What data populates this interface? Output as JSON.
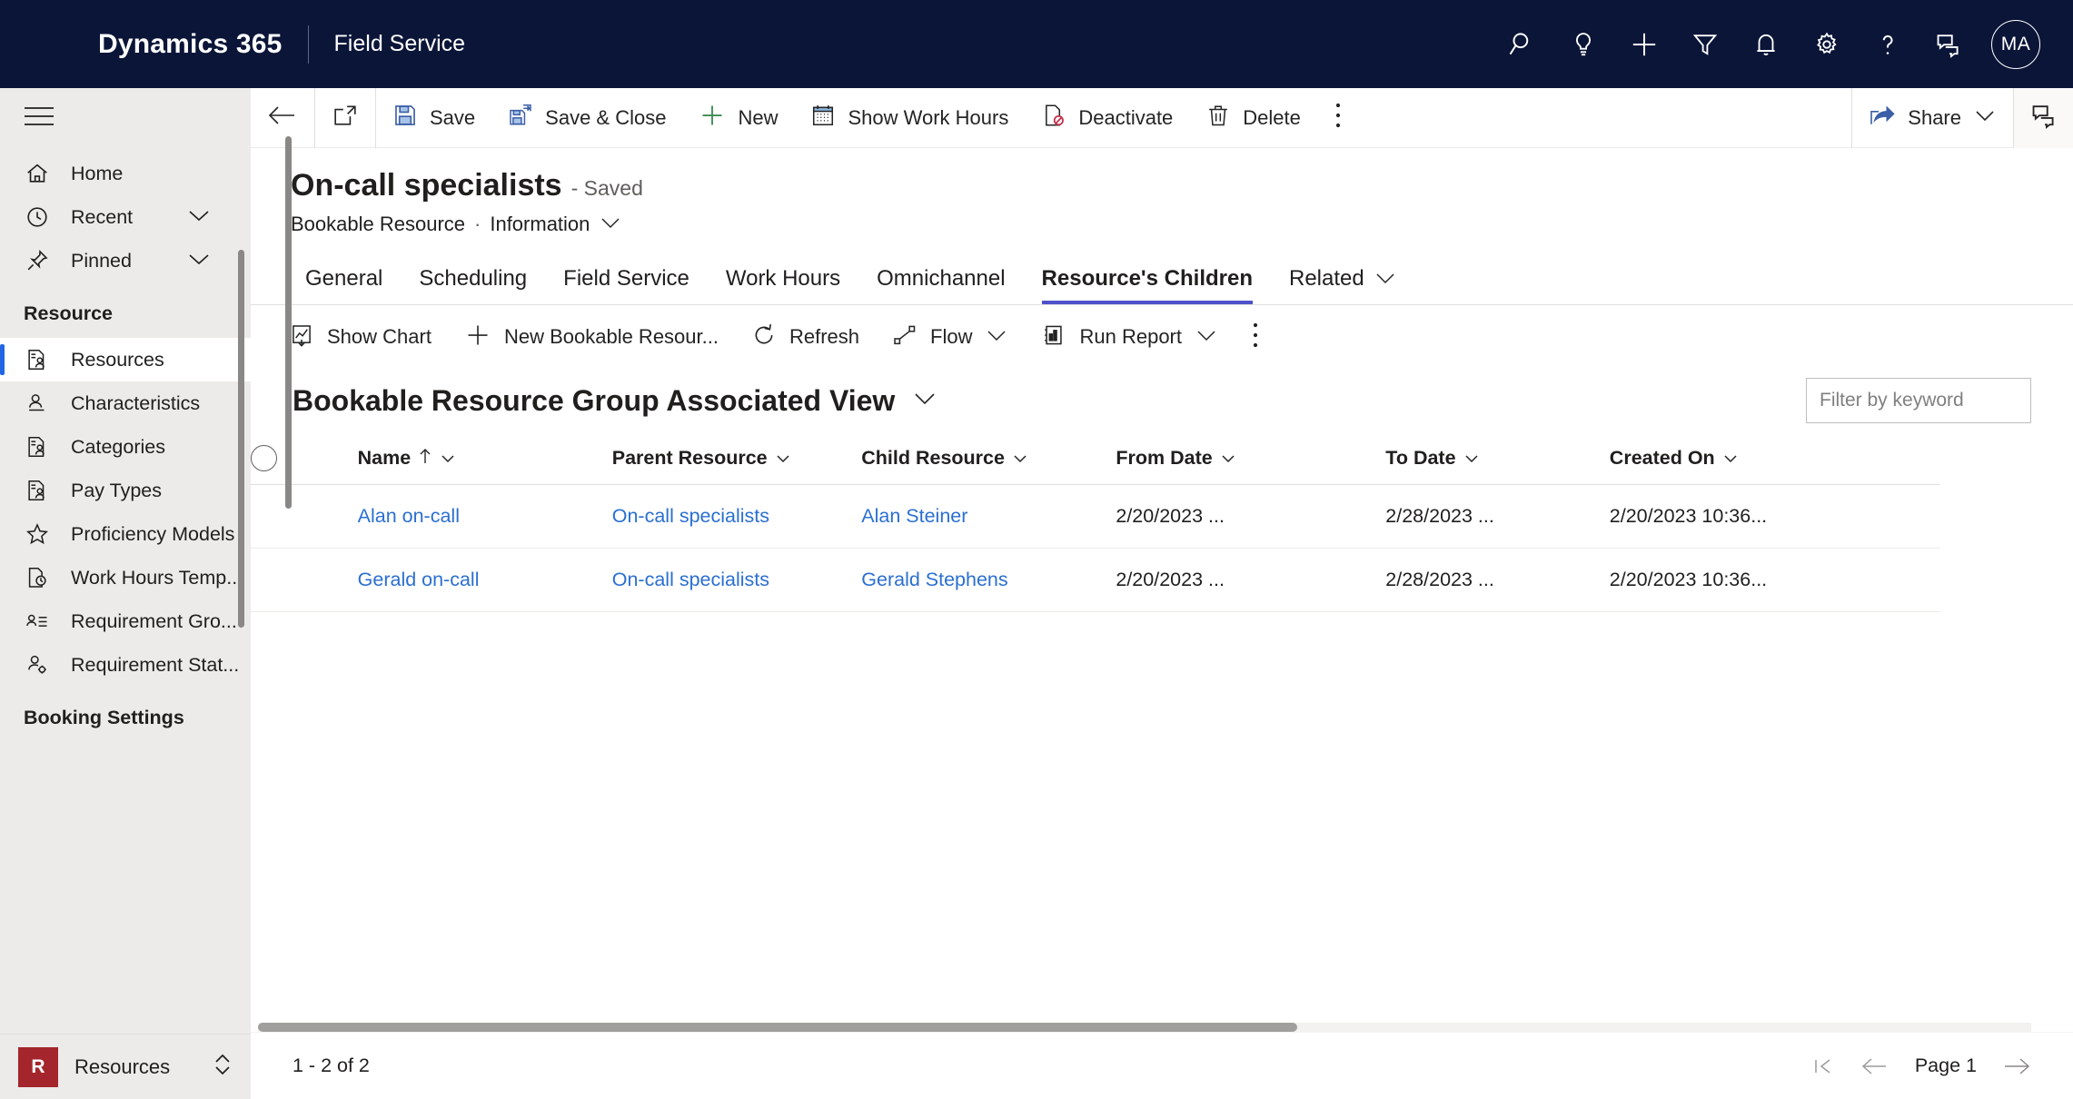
{
  "topbar": {
    "brand": "Dynamics 365",
    "app_name": "Field Service",
    "icons": [
      {
        "name": "search-icon",
        "title": "Search"
      },
      {
        "name": "lightbulb-icon",
        "title": "Insights"
      },
      {
        "name": "plus-icon",
        "title": "New"
      },
      {
        "name": "filter-icon",
        "title": "Filter"
      },
      {
        "name": "bell-icon",
        "title": "Notifications"
      },
      {
        "name": "gear-icon",
        "title": "Settings"
      },
      {
        "name": "question-icon",
        "title": "Help"
      },
      {
        "name": "chat-icon",
        "title": "Feedback"
      }
    ],
    "avatar_initials": "MA"
  },
  "sidebar": {
    "hamburger": "site-map-icon",
    "items": [
      {
        "label": "Home",
        "icon": "home-icon",
        "chevron": false,
        "active": false
      },
      {
        "label": "Recent",
        "icon": "clock-icon",
        "chevron": true,
        "active": false
      },
      {
        "label": "Pinned",
        "icon": "pin-icon",
        "chevron": true,
        "active": false
      }
    ],
    "group_label": "Resource",
    "group_items": [
      {
        "label": "Resources",
        "icon": "resource-icon",
        "active": true
      },
      {
        "label": "Characteristics",
        "icon": "person-line-icon",
        "active": false
      },
      {
        "label": "Categories",
        "icon": "resource-icon",
        "active": false
      },
      {
        "label": "Pay Types",
        "icon": "resource-icon",
        "active": false
      },
      {
        "label": "Proficiency Models",
        "icon": "star-icon",
        "active": false
      },
      {
        "label": "Work Hours Temp...",
        "icon": "clock-doc-icon",
        "active": false
      },
      {
        "label": "Requirement Gro...",
        "icon": "requirement-icon",
        "active": false
      },
      {
        "label": "Requirement Stat...",
        "icon": "person-gear-icon",
        "active": false
      }
    ],
    "group2_label": "Booking Settings",
    "footer": {
      "badge": "R",
      "name": "Resources",
      "switcher_icon": "chevron-updown-icon"
    }
  },
  "commandbar": {
    "back": "back-arrow-icon",
    "popout": "open-in-new-icon",
    "buttons": [
      {
        "label": "Save",
        "icon": "save-icon"
      },
      {
        "label": "Save & Close",
        "icon": "save-close-icon"
      },
      {
        "label": "New",
        "icon": "plus-icon"
      },
      {
        "label": "Show Work Hours",
        "icon": "calendar-icon"
      },
      {
        "label": "Deactivate",
        "icon": "deactivate-icon"
      },
      {
        "label": "Delete",
        "icon": "trash-icon"
      }
    ],
    "overflow": "more-vertical-icon",
    "share_label": "Share",
    "share_icon": "share-icon",
    "feedback_icon": "feedback-icon"
  },
  "record": {
    "title": "On-call specialists",
    "status": "- Saved",
    "entity": "Bookable Resource",
    "separator": "·",
    "form": "Information"
  },
  "tabs": [
    {
      "label": "General",
      "active": false,
      "chevron": false
    },
    {
      "label": "Scheduling",
      "active": false,
      "chevron": false
    },
    {
      "label": "Field Service",
      "active": false,
      "chevron": false
    },
    {
      "label": "Work Hours",
      "active": false,
      "chevron": false
    },
    {
      "label": "Omnichannel",
      "active": false,
      "chevron": false
    },
    {
      "label": "Resource's Children",
      "active": true,
      "chevron": false
    },
    {
      "label": "Related",
      "active": false,
      "chevron": true
    }
  ],
  "subcommandbar": {
    "buttons": [
      {
        "label": "Show Chart",
        "icon": "chart-icon",
        "chevron": false
      },
      {
        "label": "New Bookable Resour...",
        "icon": "plus-icon",
        "chevron": false
      },
      {
        "label": "Refresh",
        "icon": "refresh-icon",
        "chevron": false
      },
      {
        "label": "Flow",
        "icon": "flow-icon",
        "chevron": true
      },
      {
        "label": "Run Report",
        "icon": "report-icon",
        "chevron": true
      }
    ],
    "overflow": "more-vertical-icon"
  },
  "view": {
    "title": "Bookable Resource Group Associated View",
    "selector_icon": "chevron-down-icon",
    "filter_placeholder": "Filter by keyword",
    "filter_value": ""
  },
  "table": {
    "select_all": "select-all-circle",
    "columns": [
      {
        "label": "Name",
        "sorted": true,
        "sort_dir": "asc",
        "chevron": true
      },
      {
        "label": "Parent Resource",
        "sorted": false,
        "chevron": true
      },
      {
        "label": "Child Resource",
        "sorted": false,
        "chevron": true
      },
      {
        "label": "From Date",
        "sorted": false,
        "chevron": true
      },
      {
        "label": "To Date",
        "sorted": false,
        "chevron": true
      },
      {
        "label": "Created On",
        "sorted": false,
        "chevron": true
      }
    ],
    "rows": [
      {
        "name": "Alan on-call",
        "parent_resource": "On-call specialists",
        "child_resource": "Alan Steiner",
        "from_date": "2/20/2023 ...",
        "to_date": "2/28/2023 ...",
        "created_on": "2/20/2023 10:36..."
      },
      {
        "name": "Gerald on-call",
        "parent_resource": "On-call specialists",
        "child_resource": "Gerald Stephens",
        "from_date": "2/20/2023 ...",
        "to_date": "2/28/2023 ...",
        "created_on": "2/20/2023 10:36..."
      }
    ]
  },
  "pager": {
    "count_text": "1 - 2 of 2",
    "first_icon": "first-page-icon",
    "prev_icon": "prev-page-icon",
    "page_label": "Page 1",
    "next_icon": "next-page-icon"
  },
  "colors": {
    "topbar_bg": "#0B1538",
    "accent": "#2266E3",
    "tab_underline": "#4F52C9",
    "link": "#2A6FD1",
    "sidebar_bg": "#EDEBE9",
    "badge_red": "#A4262C"
  }
}
